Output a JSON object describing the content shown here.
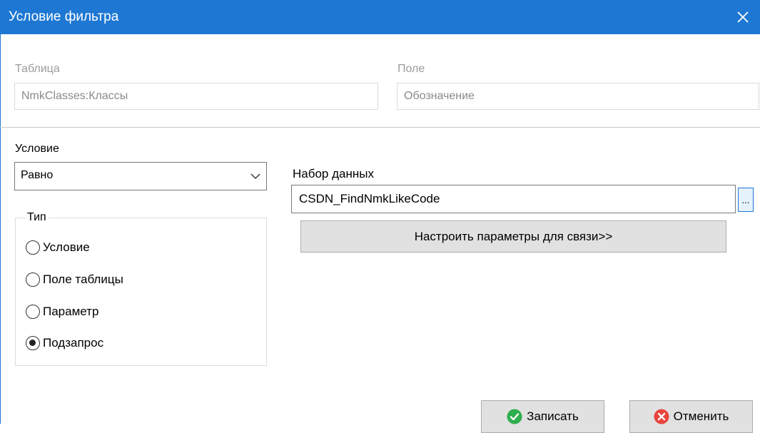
{
  "window": {
    "title": "Условие фильтра"
  },
  "table": {
    "label": "Таблица",
    "value": "NmkClasses:Классы"
  },
  "field": {
    "label": "Поле",
    "value": "Обозначение"
  },
  "condition": {
    "label": "Условие",
    "selected": "Равно"
  },
  "type_group": {
    "title": "Тип",
    "options": [
      {
        "label": "Условие",
        "selected": false
      },
      {
        "label": "Поле таблицы",
        "selected": false
      },
      {
        "label": "Параметр",
        "selected": false
      },
      {
        "label": "Подзапрос",
        "selected": true
      }
    ]
  },
  "dataset": {
    "label": "Набор данных",
    "value": "CSDN_FindNmkLikeCode",
    "browse_label": "..."
  },
  "configure_button": {
    "label": "Настроить параметры для связи>>"
  },
  "buttons": {
    "save": "Записать",
    "cancel": "Отменить"
  },
  "icons": {
    "close": "close-icon",
    "save": "check-circle-icon",
    "cancel": "x-circle-icon"
  },
  "colors": {
    "titlebar": "#1e78d3",
    "save_icon": "#2eae4e",
    "cancel_icon": "#e8453c"
  }
}
